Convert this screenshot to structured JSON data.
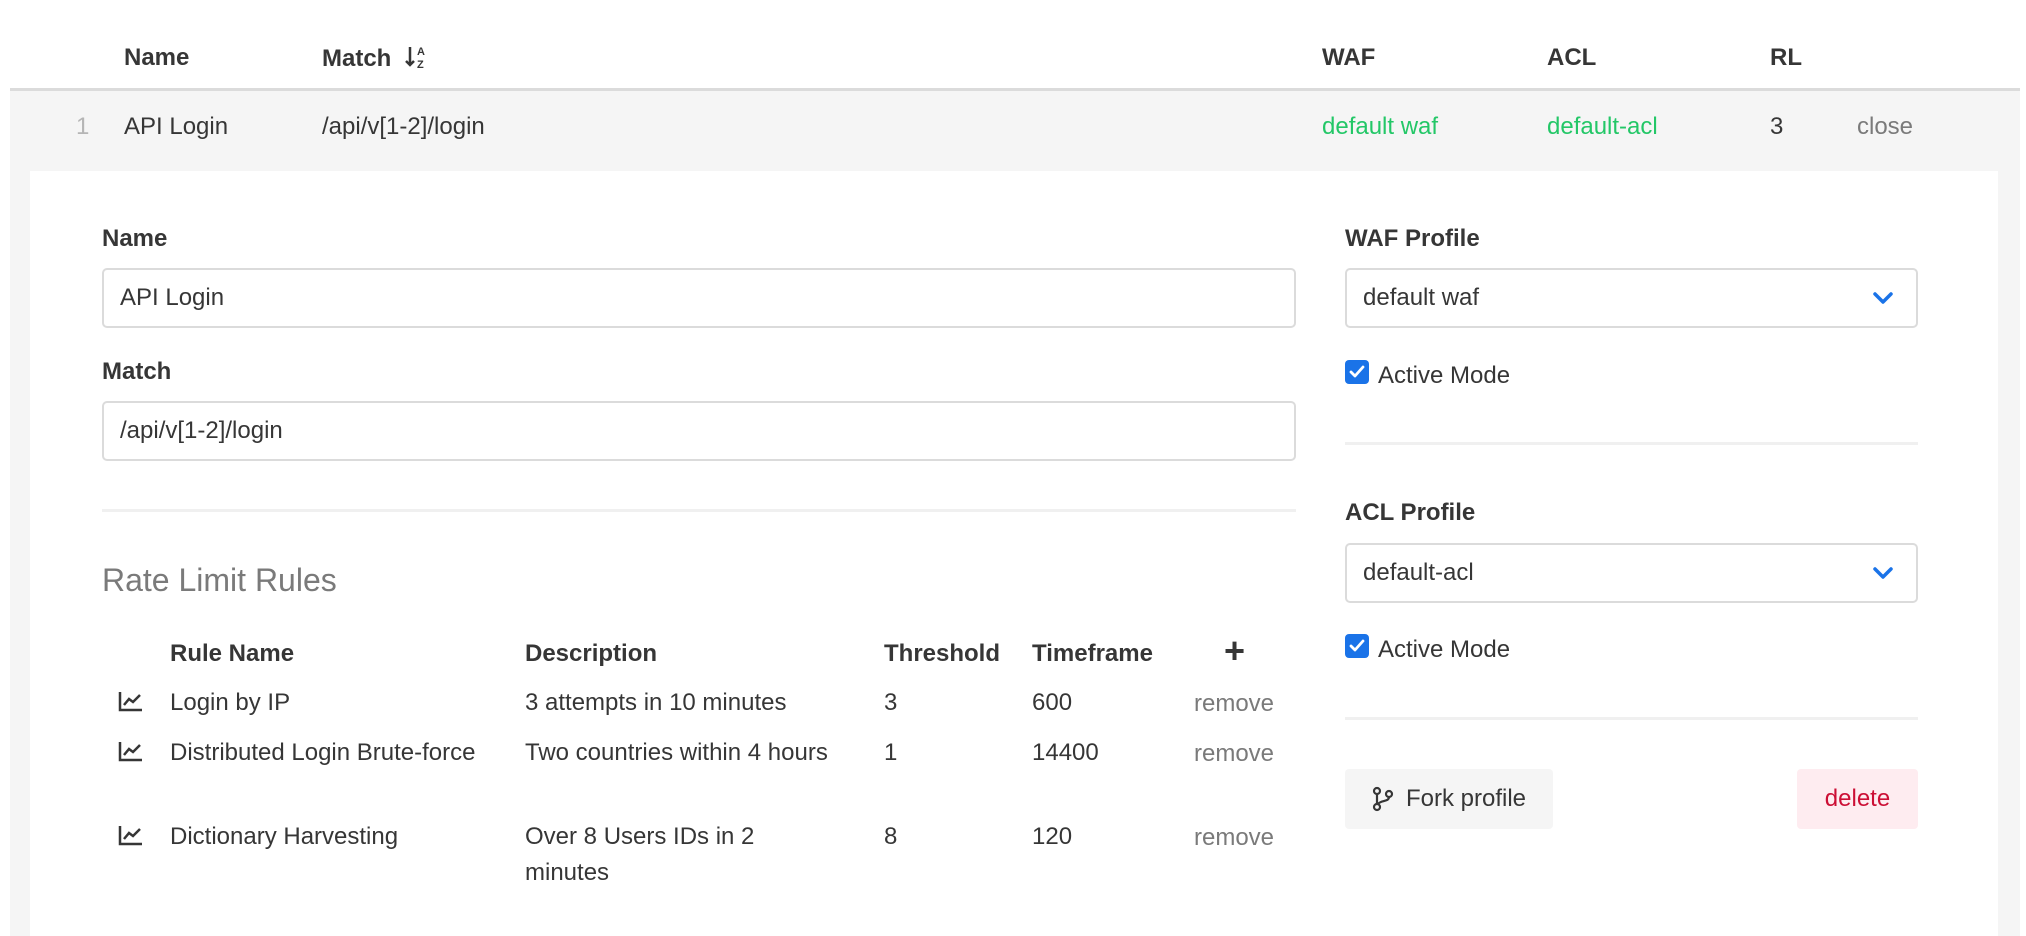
{
  "table": {
    "headers": {
      "name": "Name",
      "match": "Match",
      "waf": "WAF",
      "acl": "ACL",
      "rl": "RL"
    },
    "row": {
      "index": "1",
      "name": "API Login",
      "match": "/api/v[1-2]/login",
      "waf": "default waf",
      "acl": "default-acl",
      "rl": "3",
      "close_label": "close"
    }
  },
  "form": {
    "name_label": "Name",
    "name_value": "API Login",
    "match_label": "Match",
    "match_value": "/api/v[1-2]/login",
    "rate_limit_title": "Rate Limit Rules",
    "rules_headers": {
      "rule_name": "Rule Name",
      "description": "Description",
      "threshold": "Threshold",
      "timeframe": "Timeframe",
      "add": "+"
    },
    "rules": [
      {
        "rule_name": "Login by IP",
        "description": "3 attempts in 10 minutes",
        "threshold": "3",
        "timeframe": "600",
        "remove": "remove"
      },
      {
        "rule_name": "Distributed Login Brute-force",
        "description": "Two countries within 4 hours",
        "threshold": "1",
        "timeframe": "14400",
        "remove": "remove"
      },
      {
        "rule_name": "Dictionary Harvesting",
        "description": "Over 8 Users IDs in 2 minutes",
        "threshold": "8",
        "timeframe": "120",
        "remove": "remove"
      }
    ]
  },
  "side": {
    "waf_label": "WAF Profile",
    "waf_value": "default waf",
    "waf_active_label": "Active Mode",
    "waf_active_checked": true,
    "acl_label": "ACL Profile",
    "acl_value": "default-acl",
    "acl_active_label": "Active Mode",
    "acl_active_checked": true,
    "fork_label": "Fork profile",
    "delete_label": "delete"
  },
  "colors": {
    "profile_link": "#23c767",
    "accent": "#1a73e8",
    "delete_text": "#cc0f35",
    "delete_bg": "#feecf0"
  },
  "icons": {
    "sort": "sort-alpha-down-icon",
    "rule_row": "chart-line-icon",
    "select": "chevron-down-icon",
    "fork": "code-branch-icon",
    "add": "plus-icon"
  }
}
